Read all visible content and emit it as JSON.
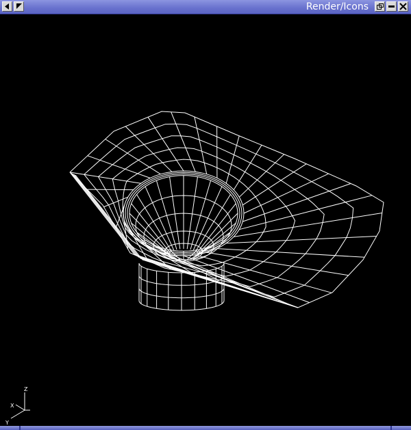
{
  "window": {
    "title": "Render/Icons"
  },
  "buttons": {
    "left_1_icon": "window-menu-icon",
    "left_2_icon": "shade-arrow-icon",
    "restore_icon": "restore-icon",
    "minimize_icon": "minimize-icon",
    "close_icon": "close-icon"
  },
  "triad": {
    "z_label": "Z",
    "x_label": "X",
    "y_label": "Y"
  },
  "colors": {
    "titlebar": "#6a73cf",
    "viewport_bg": "#000000",
    "wire": "#ffffff"
  }
}
